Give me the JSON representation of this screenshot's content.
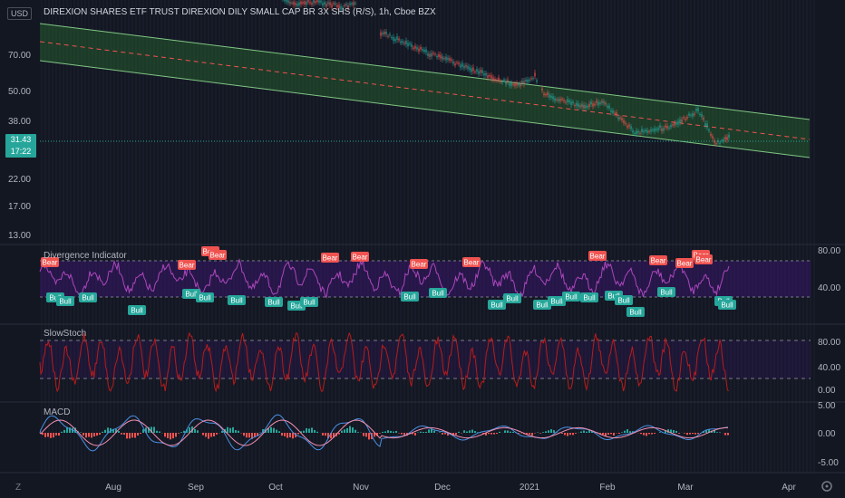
{
  "header": {
    "title": "DIREXION SHARES ETF TRUST DIREXION DILY SMALL CAP BR 3X SHS (R/S), 1h, Cboe BZX",
    "currency": "USD"
  },
  "price_axis": {
    "ticks": [
      "70.00",
      "50.00",
      "38.00",
      "22.00",
      "17.00",
      "13.00"
    ],
    "last_price": "31.43",
    "countdown": "17:22"
  },
  "panes": {
    "divergence": {
      "label": "Divergence Indicator",
      "ticks": [
        "80.00",
        "40.00"
      ]
    },
    "slowstoch": {
      "label": "SlowStoch",
      "ticks": [
        "80.00",
        "40.00",
        "0.00"
      ]
    },
    "macd": {
      "label": "MACD",
      "ticks": [
        "5.00",
        "0.00",
        "-5.00"
      ]
    }
  },
  "time_axis": {
    "labels": [
      "Aug",
      "Sep",
      "Oct",
      "Nov",
      "Dec",
      "2021",
      "Feb",
      "Mar",
      "Apr"
    ]
  },
  "signals": {
    "bear_label": "Bear",
    "bull_label": "Bull"
  },
  "toolbar": {
    "zoom_icon": "Z",
    "settings_icon": "gear-icon"
  },
  "colors": {
    "background": "#131722",
    "channel_fill": "#2e7d32",
    "channel_edge": "#81c784",
    "midline": "#ef5350",
    "up": "#26a69a",
    "down": "#ef5350",
    "divergence": "#ab47bc",
    "stoch": "#b71c1c",
    "macd": "#4a90e2",
    "signal": "#f48fb1"
  }
}
